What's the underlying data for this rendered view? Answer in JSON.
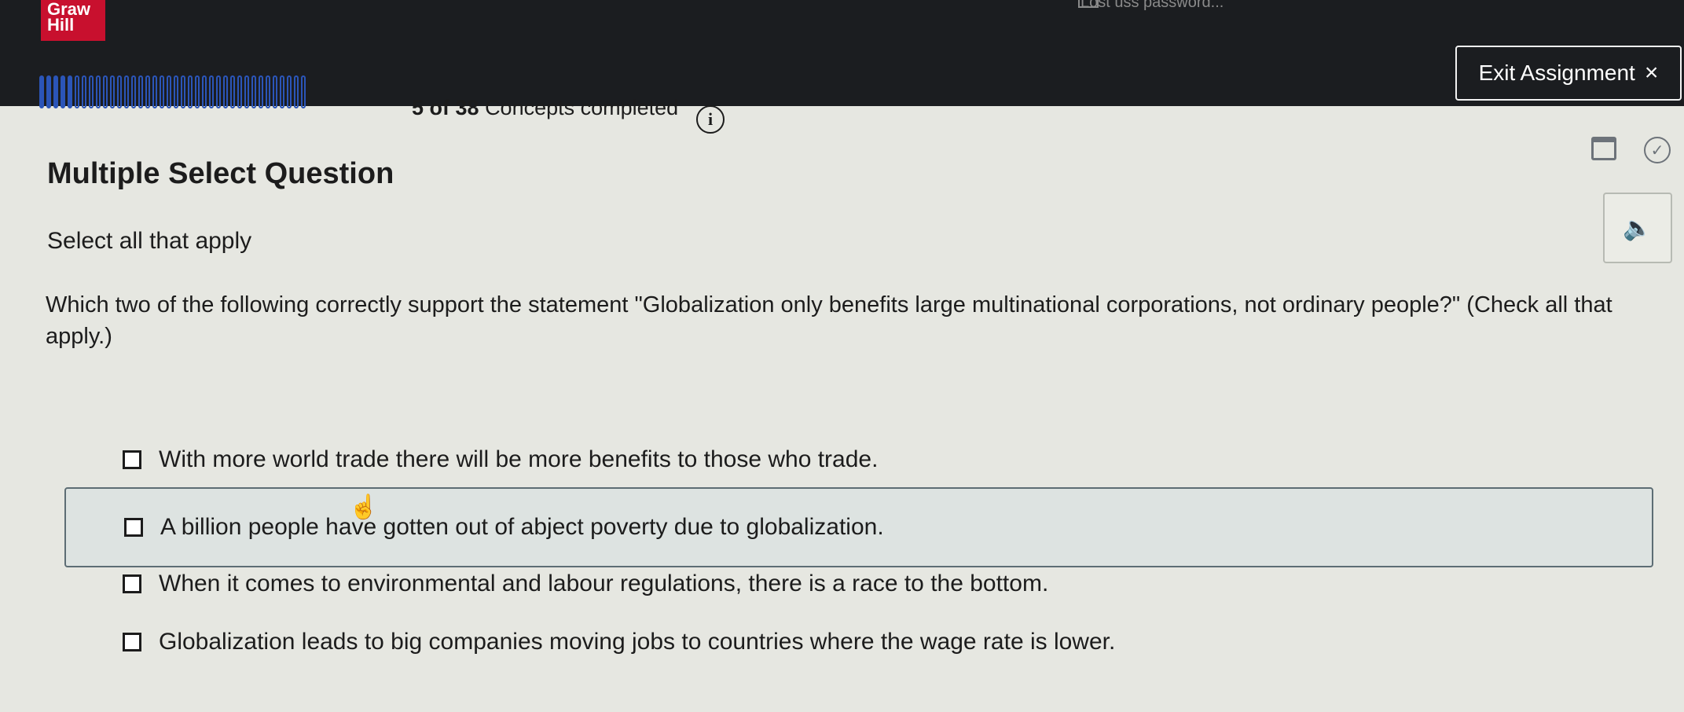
{
  "brand": {
    "logo_line1": "Graw",
    "logo_line2": "Hill"
  },
  "header": {
    "ghost_text": "Lost uss password...",
    "exit_label": "Exit Assignment",
    "exit_icon": "×"
  },
  "progress": {
    "completed": 5,
    "total": 38,
    "count_text": "5 of 38",
    "suffix_text": "Concepts completed",
    "info_icon": "i",
    "accent": "#2b55b8"
  },
  "question": {
    "type": "Multiple Select Question",
    "instruction": "Select all that apply",
    "prompt": "Which two of the following correctly support the statement \"Globalization only benefits large multinational corporations, not ordinary people?\" (Check all that apply.)",
    "options": [
      {
        "label": "With more world trade there will be more benefits to those who trade.",
        "checked": false,
        "highlighted": false
      },
      {
        "label": "A billion people have gotten out of abject poverty due to globalization.",
        "checked": false,
        "highlighted": true
      },
      {
        "label": "When it comes to environmental and labour regulations, there is a race to the bottom.",
        "checked": false,
        "highlighted": false
      },
      {
        "label": "Globalization leads to big companies moving jobs to countries where the wage rate is lower.",
        "checked": false,
        "highlighted": false
      }
    ]
  },
  "icons": {
    "calendar": "calendar-icon",
    "check": "check-circle-icon",
    "audio": "speaker-icon"
  }
}
